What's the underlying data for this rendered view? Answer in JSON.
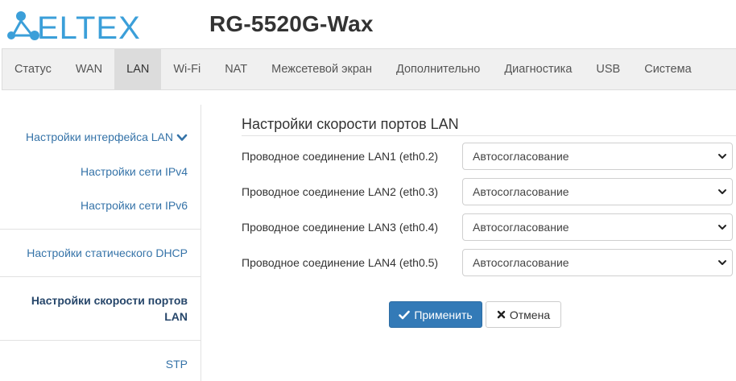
{
  "header": {
    "logo_icon": "eltex-logo-icon",
    "logo_text": "ELTEX",
    "device_title": "RG-5520G-Wax",
    "brand_color": "#3b9fd9"
  },
  "topnav": {
    "tabs": [
      {
        "label": "Статус"
      },
      {
        "label": "WAN"
      },
      {
        "label": "LAN",
        "active": true
      },
      {
        "label": "Wi-Fi"
      },
      {
        "label": "NAT"
      },
      {
        "label": "Межсетевой экран"
      },
      {
        "label": "Дополнительно"
      },
      {
        "label": "Диагностика"
      },
      {
        "label": "USB"
      },
      {
        "label": "Система"
      }
    ]
  },
  "sidebar": {
    "items": [
      {
        "label": "Настройки интерфейса LAN",
        "icon": "chevron-down-icon"
      },
      {
        "label": "Настройки сети IPv4"
      },
      {
        "label": "Настройки сети IPv6"
      },
      {
        "label": "Настройки статического DHCP"
      },
      {
        "label_line1": "Настройки скорости портов",
        "label_line2": "LAN",
        "active": true
      },
      {
        "label": "STP"
      }
    ]
  },
  "main": {
    "section_title": "Настройки скорости портов LAN",
    "rows": [
      {
        "label": "Проводное соединение LAN1 (eth0.2)",
        "value": "Автосогласование"
      },
      {
        "label": "Проводное соединение LAN2 (eth0.3)",
        "value": "Автосогласование"
      },
      {
        "label": "Проводное соединение LAN3 (eth0.4)",
        "value": "Автосогласование"
      },
      {
        "label": "Проводное соединение LAN4 (eth0.5)",
        "value": "Автосогласование"
      }
    ],
    "apply_label": "Применить",
    "cancel_label": "Отмена",
    "apply_color": "#337ab7"
  }
}
